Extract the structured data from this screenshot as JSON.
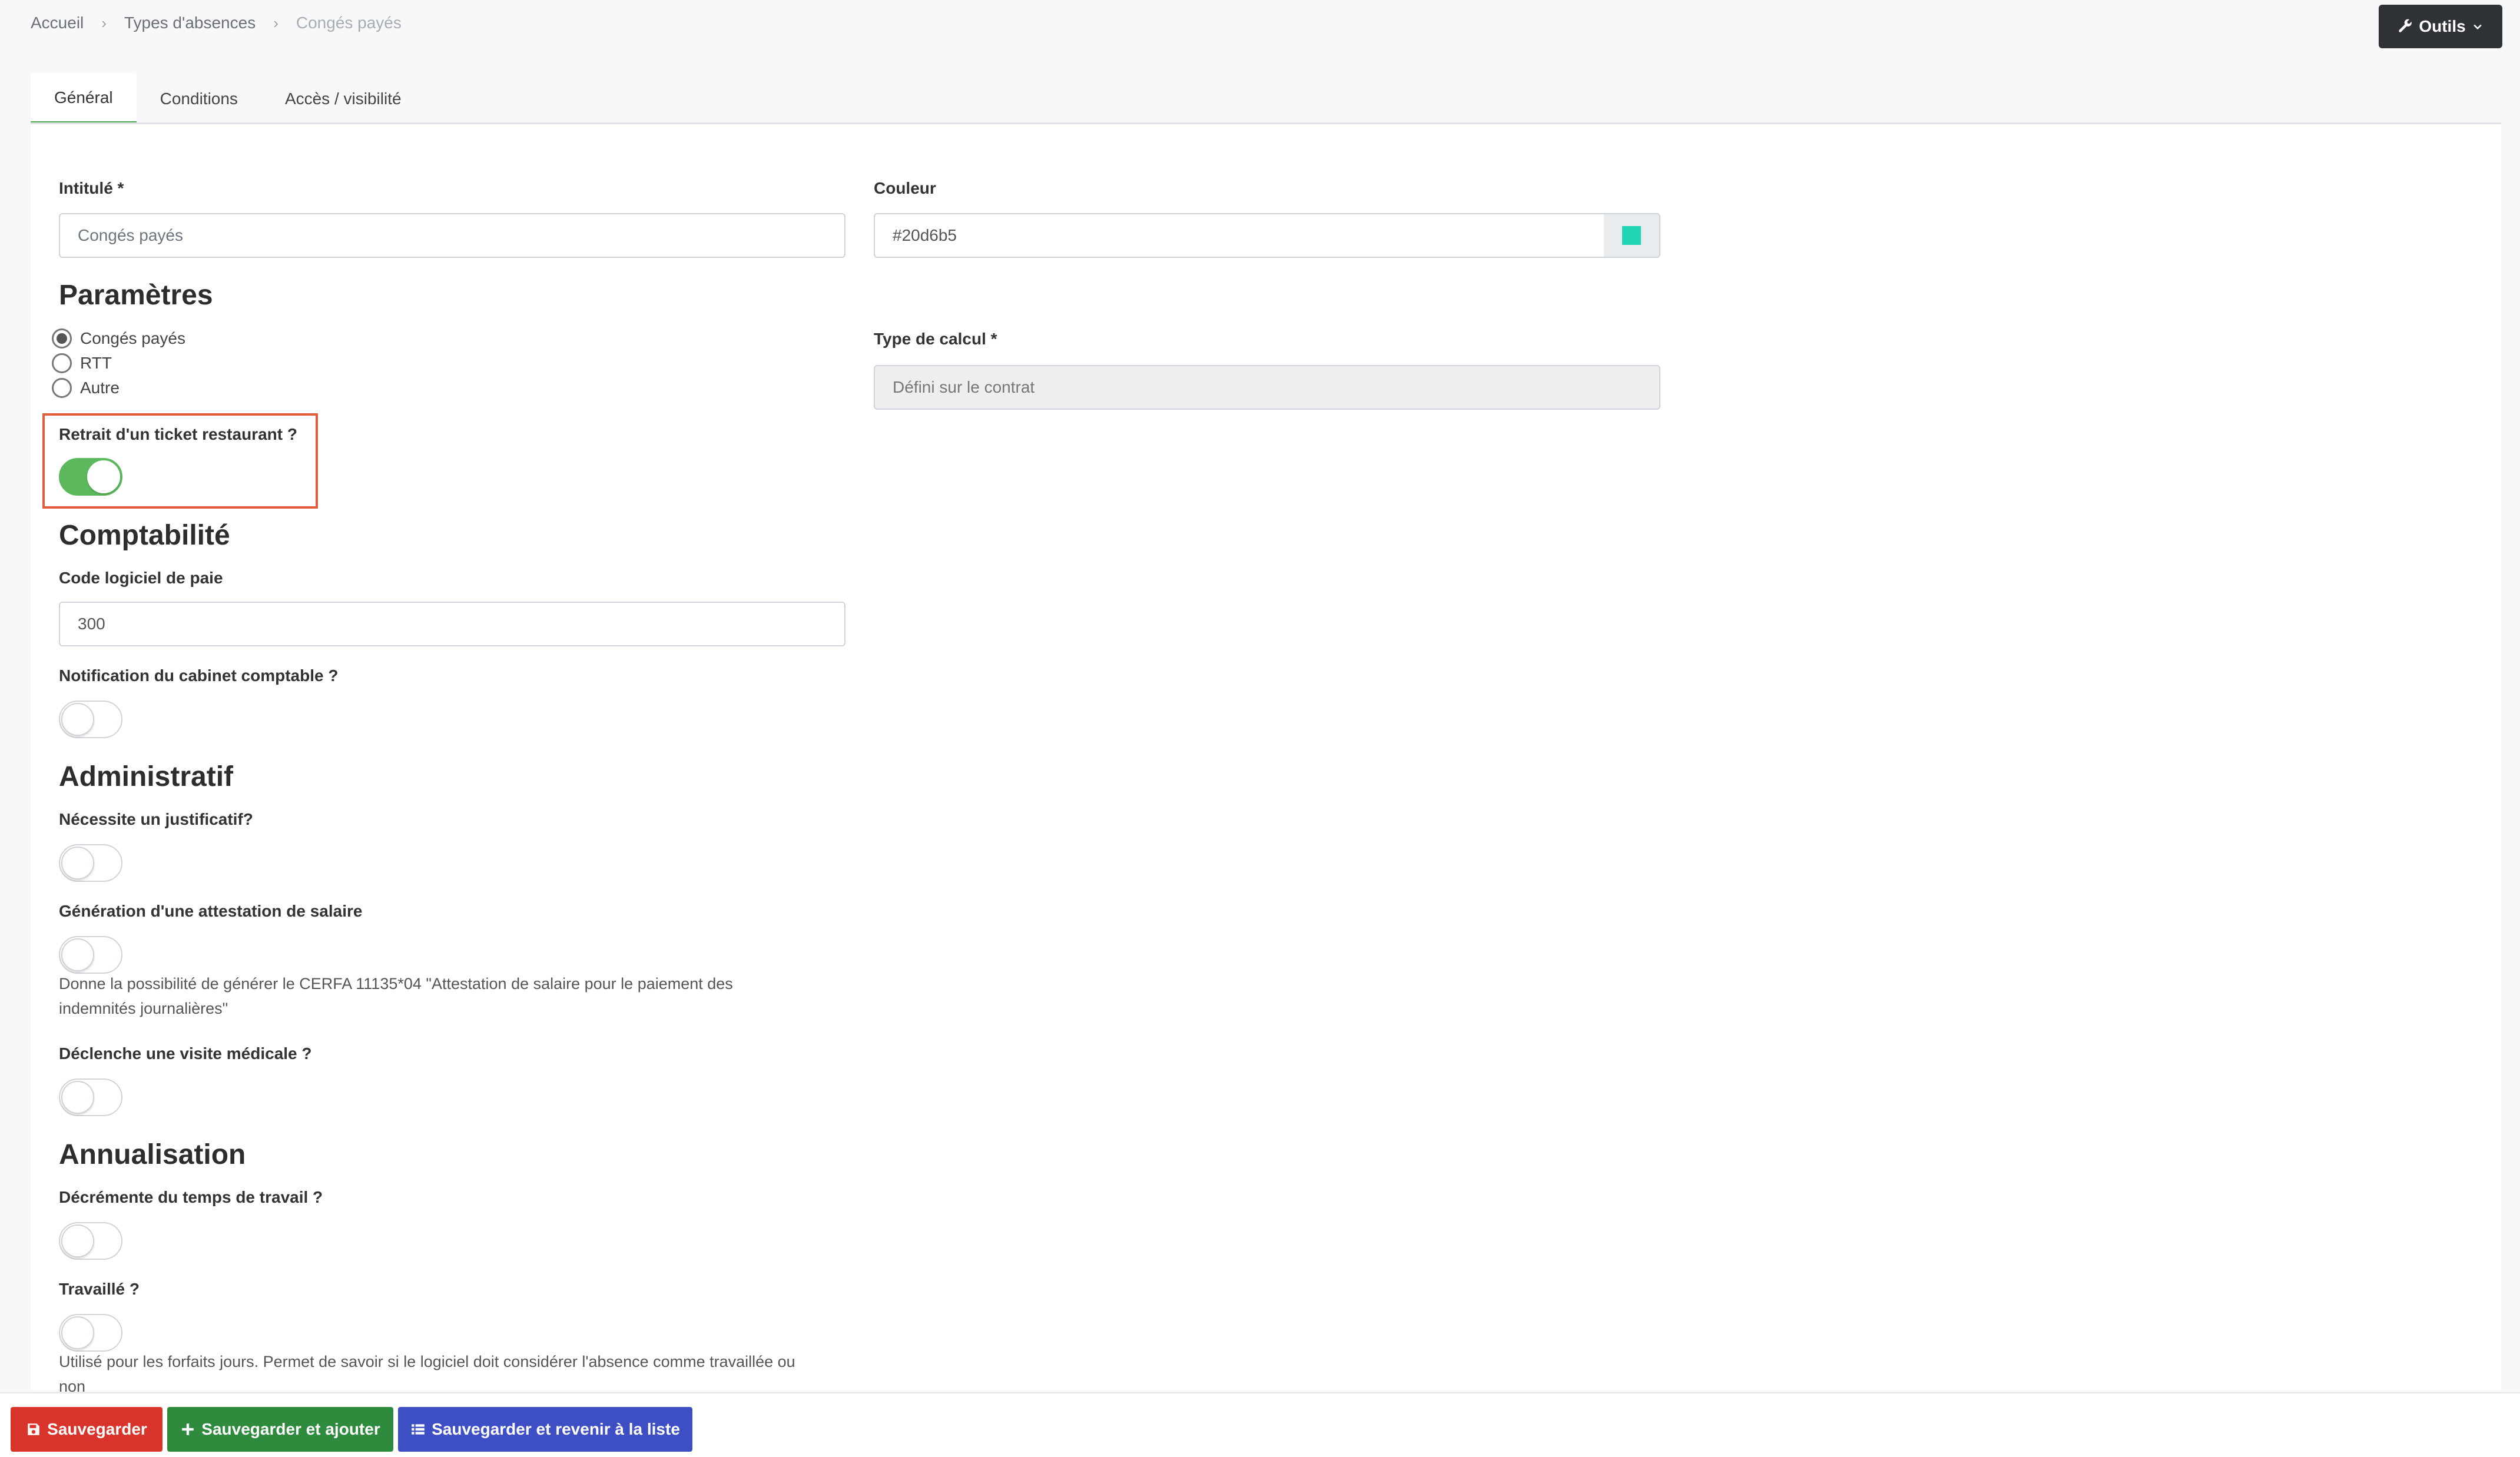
{
  "breadcrumb": {
    "home": "Accueil",
    "section": "Types d'absences",
    "current": "Congés payés"
  },
  "toolbar": {
    "tools_label": "Outils"
  },
  "tabs": [
    {
      "label": "Général",
      "active": true
    },
    {
      "label": "Conditions",
      "active": false
    },
    {
      "label": "Accès / visibilité",
      "active": false
    }
  ],
  "form": {
    "title_label": "Intitulé *",
    "title_placeholder": "Congés payés",
    "color_label": "Couleur",
    "color_value": "#20d6b5",
    "params_title": "Paramètres",
    "param_options": [
      {
        "label": "Congés payés",
        "checked": true
      },
      {
        "label": "RTT",
        "checked": false
      },
      {
        "label": "Autre",
        "checked": false
      }
    ],
    "calc_type_label": "Type de calcul *",
    "calc_type_value": "Défini sur le contrat",
    "ticket_label": "Retrait d'un ticket restaurant ?",
    "ticket_on": true,
    "compta_title": "Comptabilité",
    "payroll_code_label": "Code logiciel de paie",
    "payroll_code_value": "300",
    "notif_label": "Notification du cabinet comptable ?",
    "admin_title": "Administratif",
    "justif_label": "Nécessite un justificatif?",
    "attestation_label": "Génération d'une attestation de salaire",
    "attestation_help_1": "Donne la possibilité de générer le CERFA 11135*04 \"Attestation de salaire pour le paiement des",
    "attestation_help_2": "indemnités journalières\"",
    "visite_label": "Déclenche une visite médicale ?",
    "annual_title": "Annualisation",
    "decrement_label": "Décrémente du temps de travail ?",
    "worked_label": "Travaillé ?",
    "worked_help_1": "Utilisé pour les forfaits jours. Permet de savoir si le logiciel doit considérer l'absence comme travaillée ou",
    "worked_help_2": "non"
  },
  "footer": {
    "save": "Sauvegarder",
    "save_add": "Sauvegarder et ajouter",
    "save_back": "Sauvegarder et revenir à la liste"
  },
  "colors": {
    "save": "#d9342b",
    "save_add": "#2e8b3e",
    "save_back": "#3e4fc6",
    "toggle_on": "#5cb85c",
    "swatch": "#20d6b5"
  }
}
